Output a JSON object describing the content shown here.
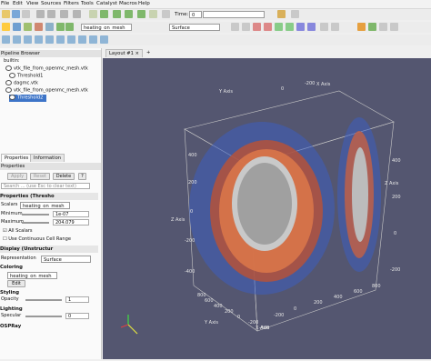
{
  "menu": {
    "items": [
      "File",
      "Edit",
      "View",
      "Sources",
      "Filters",
      "Tools",
      "Catalyst",
      "Macros",
      "Help"
    ]
  },
  "toolbar": {
    "time_label": "Time:",
    "time_value": "0",
    "array_value": "heating_on_mesh",
    "representation_value": "Surface"
  },
  "layout_tab": {
    "label": "Layout #1",
    "close": "×",
    "add": "+"
  },
  "pipeline": {
    "title": "Pipeline Browser",
    "items": [
      {
        "label": "builtin:"
      },
      {
        "label": "vtk_file_from_openmc_mesh.vtk"
      },
      {
        "label": "Threshold1"
      },
      {
        "label": "dagmc.vtk"
      },
      {
        "label": "vtk_file_from_openmc_mesh.vtk"
      },
      {
        "label": "Threshold2"
      }
    ]
  },
  "props_tabs": {
    "properties": "Properties",
    "information": "Information"
  },
  "properties_title": "Properties",
  "buttons": {
    "apply": "Apply",
    "reset": "Reset",
    "delete": "Delete",
    "help": "?",
    "edit": "Edit"
  },
  "search_placeholder": "Search ... (use Esc to clear text)",
  "section_props": "Properties (Thresho",
  "scalars": {
    "label": "Scalars",
    "value": "heating_on_mesh"
  },
  "minimum": {
    "label": "Minimum",
    "value": "1e-07"
  },
  "maximum": {
    "label": "Maximum",
    "value": "204.079"
  },
  "all_scalars": "All Scalars",
  "continuous": "Use Continuous Cell Range",
  "section_display": "Display (Unstructur",
  "representation": {
    "label": "Representation",
    "value": "Surface"
  },
  "coloring": {
    "title": "Coloring",
    "value": "heating_on_mesh"
  },
  "styling": {
    "title": "Styling",
    "opacity_label": "Opacity",
    "opacity_value": "1"
  },
  "lighting": {
    "title": "Lighting",
    "specular_label": "Specular",
    "specular_value": "0"
  },
  "ospray": "OSPRay",
  "axes": {
    "ylabel": "Y Axis",
    "xlabel": "X Axis",
    "zlabel": "Z Axis",
    "ticks_top": [
      "0",
      "-200"
    ],
    "ticks_left": [
      "400",
      "200",
      "0",
      "-200",
      "-400"
    ],
    "ticks_bottom": [
      "800",
      "600",
      "400",
      "200",
      "0",
      "-200",
      "-400"
    ],
    "ticks_right": [
      "-200",
      "0",
      "200",
      "400",
      "600",
      "800"
    ],
    "ticks_zr": [
      "400",
      "200",
      "0",
      "-200"
    ]
  },
  "colors": {
    "background": "#545670",
    "accent": "#3d74c8"
  }
}
